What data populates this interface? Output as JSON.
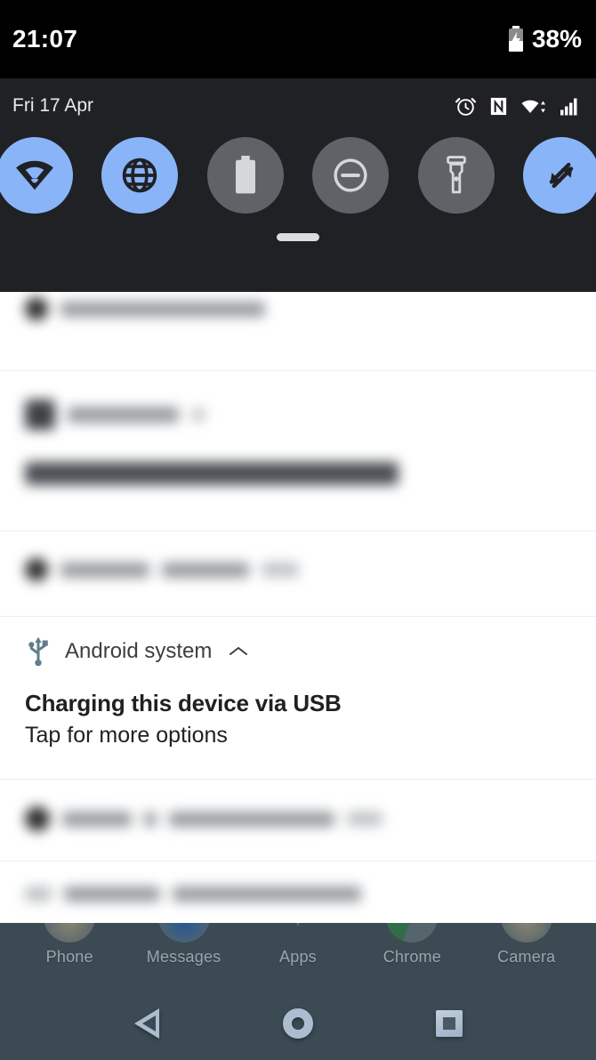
{
  "status_bar": {
    "time": "21:07",
    "battery_percent": "38%",
    "battery_icon": "battery-charging-icon"
  },
  "quick_settings": {
    "date": "Fri 17 Apr",
    "status_icons": [
      {
        "name": "alarm-icon",
        "label": "Alarm set"
      },
      {
        "name": "nfc-icon",
        "label": "NFC"
      },
      {
        "name": "wifi-icon",
        "label": "Wi-Fi connected"
      },
      {
        "name": "signal-icon",
        "label": "Mobile signal"
      }
    ],
    "tiles": [
      {
        "name": "wifi-tile",
        "label": "Wi-Fi",
        "icon": "wifi-icon",
        "state": "on"
      },
      {
        "name": "mobile-data-tile",
        "label": "Mobile data",
        "icon": "globe-icon",
        "state": "on"
      },
      {
        "name": "battery-saver-tile",
        "label": "Battery Saver",
        "icon": "battery-icon",
        "state": "off"
      },
      {
        "name": "dnd-tile",
        "label": "Do Not Disturb",
        "icon": "minus-circle-icon",
        "state": "off"
      },
      {
        "name": "flashlight-tile",
        "label": "Flashlight",
        "icon": "flashlight-icon",
        "state": "off"
      },
      {
        "name": "auto-rotate-tile",
        "label": "Auto-rotate",
        "icon": "rotate-icon",
        "state": "on"
      }
    ],
    "drag_handle": "drag-handle",
    "colors": {
      "tile_on": "#8ab4f8",
      "tile_off": "#5f6368",
      "panel_bg": "#202124",
      "status_bar_bg": "#000000"
    }
  },
  "notifications": [
    {
      "name": "redacted-notification-top",
      "redacted": true,
      "app": "",
      "title": "",
      "body": ""
    },
    {
      "name": "redacted-notification-background-app",
      "redacted": true,
      "app": "",
      "title": "",
      "body": ""
    },
    {
      "name": "redacted-notification-android",
      "redacted": true,
      "app": "",
      "title": "",
      "body": ""
    },
    {
      "name": "android-system-usb-notification",
      "redacted": false,
      "app": "Android system",
      "app_icon": "usb-icon",
      "expand_icon": "chevron-up-icon",
      "title": "Charging this device via USB",
      "body": "Tap for more options"
    },
    {
      "name": "redacted-notification-google",
      "redacted": true,
      "app": "",
      "title": "",
      "body": ""
    },
    {
      "name": "redacted-notification-settings",
      "redacted": true,
      "app": "",
      "title": "",
      "body": ""
    }
  ],
  "home_screen": {
    "dock": [
      {
        "name": "dock-item-phone",
        "label": "Phone",
        "icon": "phone-icon"
      },
      {
        "name": "dock-item-messages",
        "label": "Messages",
        "icon": "messages-icon"
      },
      {
        "name": "dock-item-apps",
        "label": "Apps",
        "icon": "apps-icon"
      },
      {
        "name": "dock-item-chrome",
        "label": "Chrome",
        "icon": "chrome-icon"
      },
      {
        "name": "dock-item-camera",
        "label": "Camera",
        "icon": "camera-icon"
      }
    ],
    "nav_bar": [
      {
        "name": "nav-back-button",
        "label": "Back",
        "icon": "back-triangle-icon"
      },
      {
        "name": "nav-home-button",
        "label": "Home",
        "icon": "home-circle-icon"
      },
      {
        "name": "nav-recents-button",
        "label": "Recents",
        "icon": "recents-square-icon"
      }
    ],
    "background_color": "#3b4a53"
  }
}
